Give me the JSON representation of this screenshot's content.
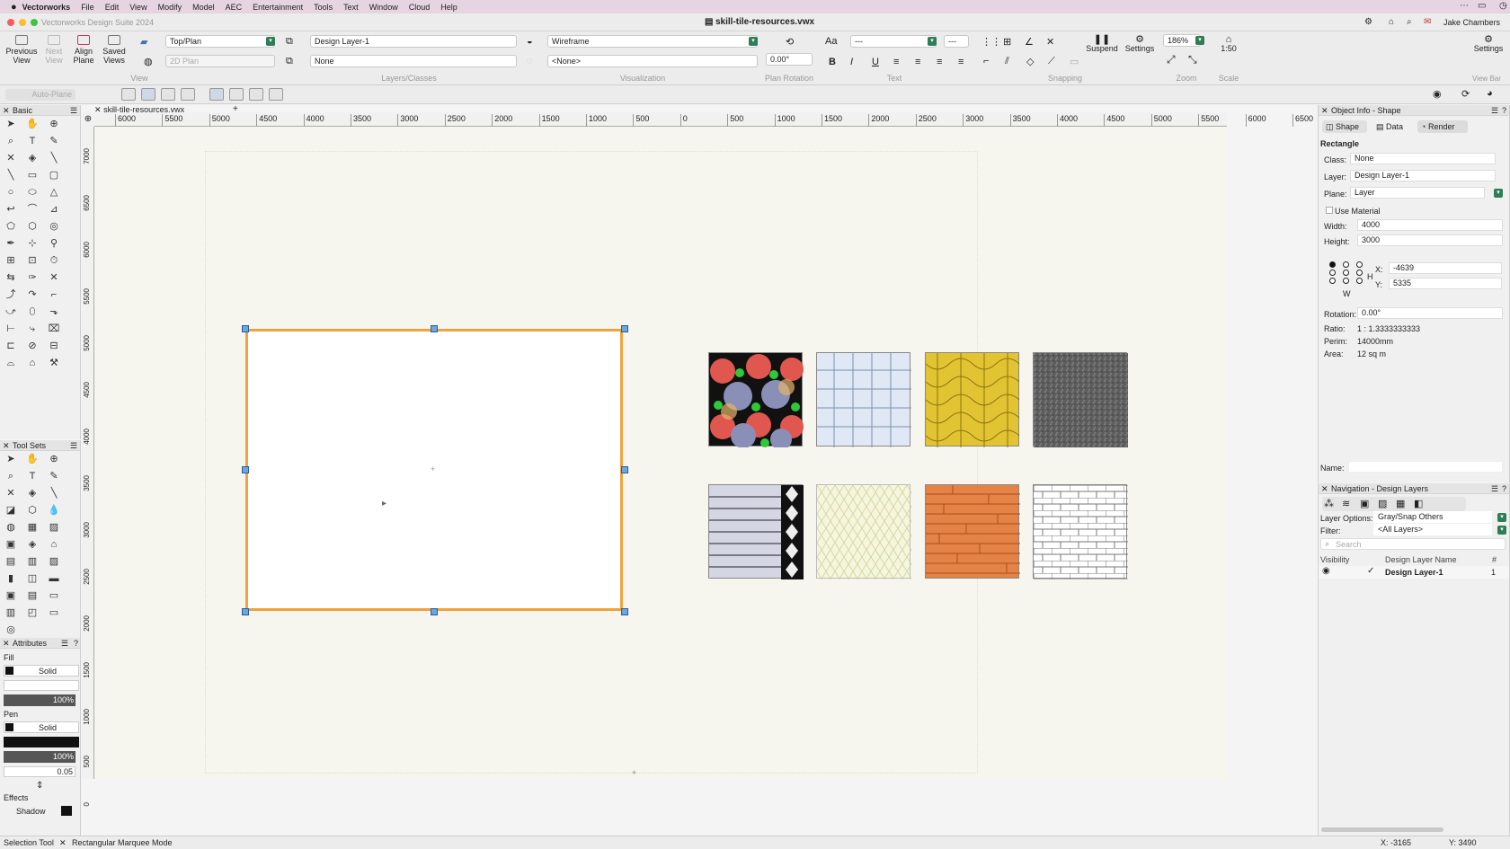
{
  "menubar": {
    "app": "Vectorworks",
    "items": [
      "File",
      "Edit",
      "View",
      "Modify",
      "Model",
      "AEC",
      "Entertainment",
      "Tools",
      "Text",
      "Window",
      "Cloud",
      "Help"
    ]
  },
  "window": {
    "app_title": "Vectorworks Design Suite 2024",
    "file_title": "skill-tile-resources.vwx",
    "user": "Jake Chambers"
  },
  "toolbar": {
    "previous_view": "Previous View",
    "next_view": "Next View",
    "align_plane": "Align Plane",
    "saved_views": "Saved Views",
    "view_dropdown": "Top/Plan",
    "plan_mode_dropdown": "2D Plan",
    "layer_dropdown": "Design Layer-1",
    "class_dropdown": "None",
    "render_dropdown": "Wireframe",
    "lightmode_dropdown": "<None>",
    "rotation_value": "0.00°",
    "font_value": "---",
    "font_size_value": "---",
    "suspend": "Suspend",
    "settings": "Settings",
    "zoom_value": "186%",
    "scale_value": "1:50",
    "settings_right": "Settings",
    "view_bar": "View Bar",
    "group_labels": {
      "view": "View",
      "layers": "Layers/Classes",
      "visualization": "Visualization",
      "plan_rotation": "Plan Rotation",
      "text": "Text",
      "snapping": "Snapping",
      "zoom": "Zoom",
      "scale": "Scale"
    }
  },
  "modebar": {
    "auto_plane": "Auto-Plane"
  },
  "palettes": {
    "basic_title": "Basic",
    "toolsets_title": "Tool Sets",
    "attributes_title": "Attributes",
    "fill_label": "Fill",
    "fill_style": "Solid",
    "fill_opacity": "100%",
    "pen_label": "Pen",
    "pen_style": "Solid",
    "pen_opacity": "100%",
    "line_weight": "0.05",
    "effects_label": "Effects",
    "shadow_label": "Shadow"
  },
  "document_tab": "skill-tile-resources.vwx",
  "ruler": {
    "top": [
      "6000",
      "5500",
      "5000",
      "4500",
      "4000",
      "3500",
      "3000",
      "2500",
      "2000",
      "1500",
      "1000",
      "500",
      "0",
      "500",
      "1000",
      "1500",
      "2000",
      "2500",
      "3000",
      "3500",
      "4000",
      "4500",
      "5000",
      "5500",
      "6000",
      "6500"
    ],
    "left": [
      "7000",
      "6500",
      "6000",
      "5500",
      "5000",
      "4500",
      "4000",
      "3500",
      "3000",
      "2500",
      "2000",
      "1500",
      "1000",
      "500",
      "0"
    ]
  },
  "object_info": {
    "title": "Object Info - Shape",
    "tabs": [
      "Shape",
      "Data",
      "Render"
    ],
    "object_type": "Rectangle",
    "class_label": "Class:",
    "class_value": "None",
    "layer_label": "Layer:",
    "layer_value": "Design Layer-1",
    "plane_label": "Plane:",
    "plane_value": "Layer",
    "use_material": "Use Material",
    "width_label": "Width:",
    "width_value": "4000",
    "height_label": "Height:",
    "height_value": "3000",
    "h_label": "H",
    "w_label": "W",
    "x_label": "X:",
    "x_value": "-4639",
    "y_label": "Y:",
    "y_value": "5335",
    "rotation_label": "Rotation:",
    "rotation_value": "0.00°",
    "ratio_label": "Ratio:",
    "ratio_value": "1 : 1.3333333333",
    "perim_label": "Perim:",
    "perim_value": "14000mm",
    "area_label": "Area:",
    "area_value": "12 sq m",
    "name_label": "Name:"
  },
  "navigation": {
    "title": "Navigation - Design Layers",
    "layer_options_label": "Layer Options:",
    "layer_options_value": "Gray/Snap Others",
    "filter_label": "Filter:",
    "filter_value": "<All Layers>",
    "search_placeholder": "Search",
    "col_visibility": "Visibility",
    "col_name": "Design Layer Name",
    "col_num": "#",
    "rows": [
      {
        "name": "Design Layer-1",
        "num": "1"
      }
    ]
  },
  "status": {
    "tool": "Selection Tool",
    "mode": "Rectangular Marquee Mode",
    "x_readout": "X: -3165",
    "y_readout": "Y: 3490"
  },
  "colors": {
    "selection": "#f0a23c",
    "handle": "#6aa6e0",
    "accent_green": "#2e7d57",
    "menubar": "#e6d4e2"
  }
}
